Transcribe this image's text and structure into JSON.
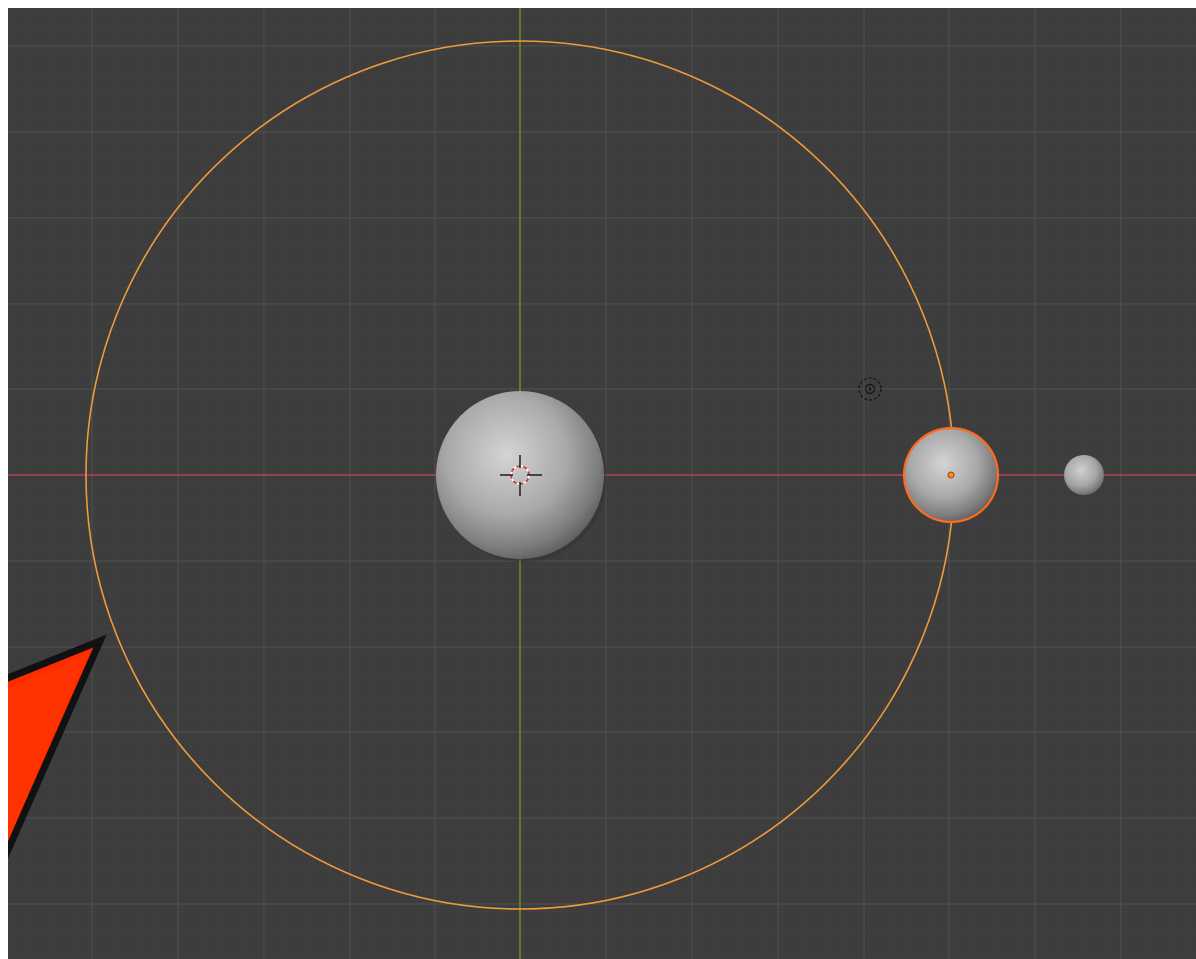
{
  "viewport": {
    "background": "#3d3d3d",
    "grid_minor_color": "#464646",
    "grid_major_color": "#4c4c4c",
    "x_axis_color": "#b2454f",
    "y_axis_color": "#6f8f2a",
    "selection_outline_color": "#f09a3a",
    "active_outline_color": "#ff6a1e",
    "annotation_arrow_color": "#ff2200"
  },
  "scene": {
    "objects": [
      {
        "id": "sun",
        "icon": "sphere-mesh"
      },
      {
        "id": "orbit-path",
        "icon": "circle-curve"
      },
      {
        "id": "planet",
        "icon": "sphere-mesh"
      },
      {
        "id": "moon",
        "icon": "sphere-mesh"
      },
      {
        "id": "light",
        "icon": "light-icon"
      },
      {
        "id": "3d-cursor",
        "icon": "3d-cursor-icon"
      }
    ]
  }
}
